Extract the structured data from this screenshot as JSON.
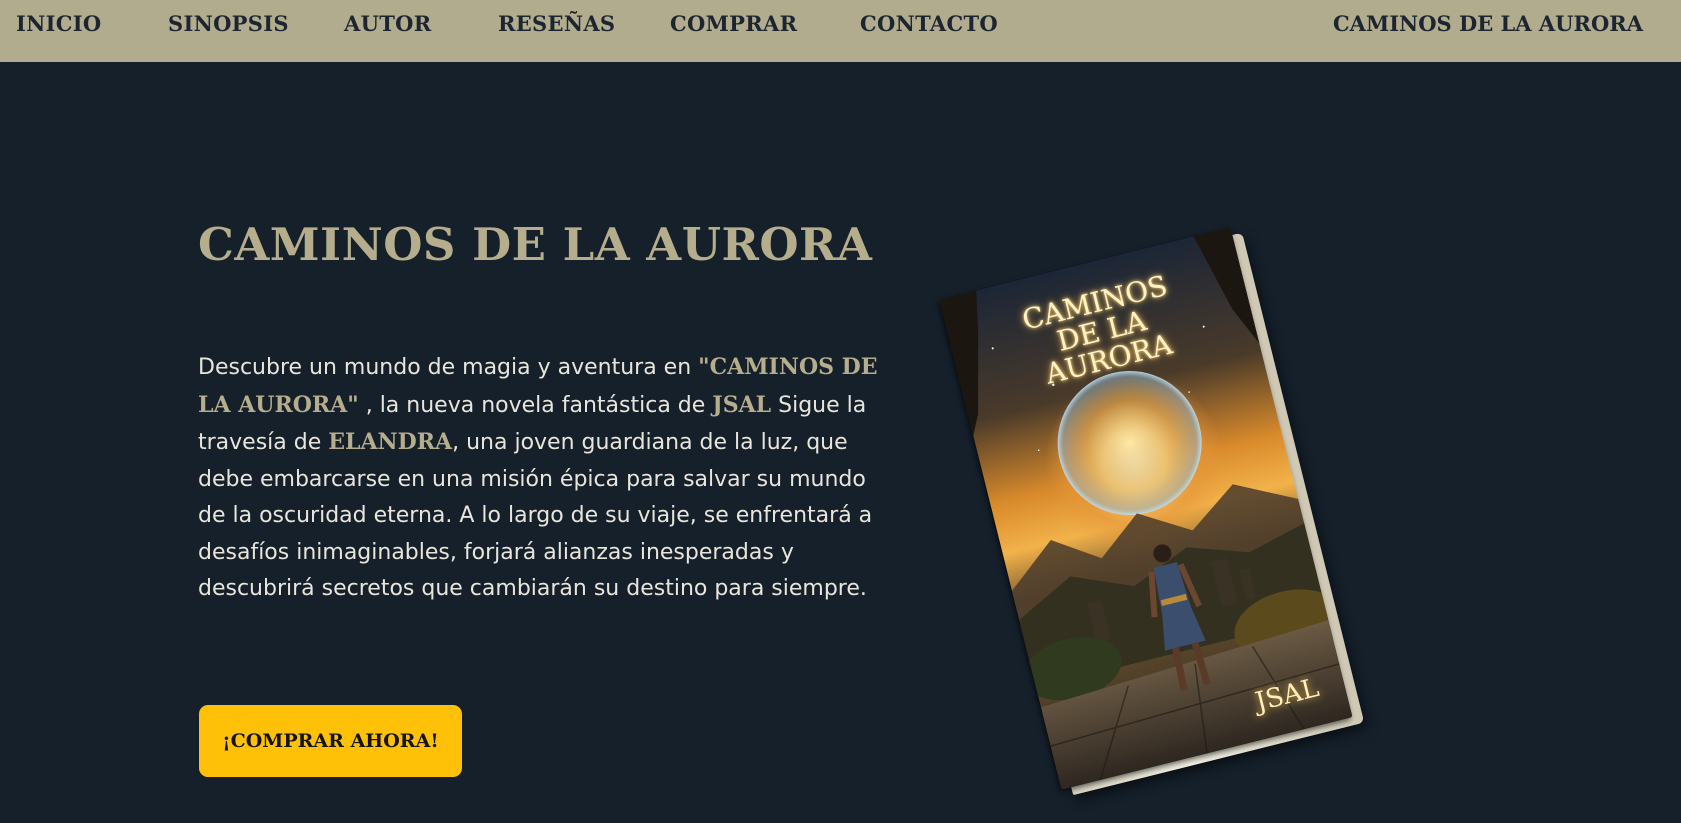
{
  "nav": {
    "links": [
      "INICIO",
      "SINOPSIS",
      "AUTOR",
      "RESEÑAS",
      "COMPRAR",
      "CONTACTO"
    ],
    "brand": "CAMINOS DE LA AURORA"
  },
  "hero": {
    "title": "CAMINOS DE LA AURORA",
    "intro_1": "Descubre un mundo de magia y aventura en ",
    "book_name": "\"CAMINOS DE LA AURORA\"",
    "intro_2": " , la nueva novela fantástica de ",
    "author": "JSAL",
    "intro_3": " Sigue la travesía de ",
    "heroine": "ELANDRA",
    "intro_4": ", una joven guardiana de la luz, que debe embarcarse en una misión épica para salvar su mundo de la oscuridad eterna. A lo largo de su viaje, se enfrentará a desafíos inimaginables, forjará alianzas inesperadas y descubrirá secretos que cambiarán su destino para siempre.",
    "cta_label": "¡COMPRAR AHORA!"
  },
  "book_cover": {
    "title_lines": [
      "CAMINOS",
      "DE LA",
      "AURORA"
    ],
    "author": "JSAL"
  },
  "colors": {
    "nav_bg": "#b1ac8d",
    "page_bg": "#15202b",
    "accent": "#b5ad8c",
    "cta_bg": "#ffc107"
  }
}
